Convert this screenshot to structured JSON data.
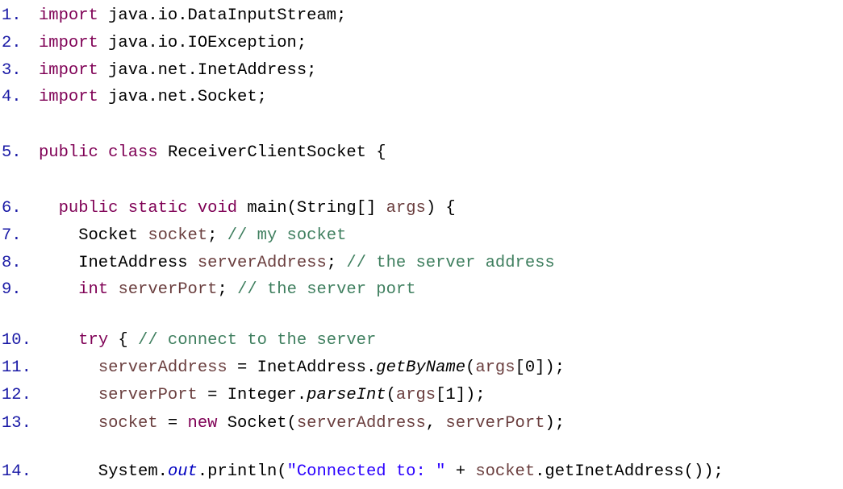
{
  "lines": [
    {
      "num": "1.",
      "tokens": [
        {
          "t": "import",
          "c": "kw"
        },
        {
          "t": " java.io.DataInputStream;",
          "c": ""
        }
      ]
    },
    {
      "num": "2.",
      "tokens": [
        {
          "t": "import",
          "c": "kw"
        },
        {
          "t": " java.io.IOException;",
          "c": ""
        }
      ]
    },
    {
      "num": "3.",
      "tokens": [
        {
          "t": "import",
          "c": "kw"
        },
        {
          "t": " java.net.InetAddress;",
          "c": ""
        }
      ]
    },
    {
      "num": "4.",
      "tokens": [
        {
          "t": "import",
          "c": "kw"
        },
        {
          "t": " java.net.Socket;",
          "c": ""
        }
      ]
    },
    {
      "num": "5.",
      "tokens": [
        {
          "t": "public",
          "c": "kw"
        },
        {
          "t": " ",
          "c": ""
        },
        {
          "t": "class",
          "c": "kw"
        },
        {
          "t": " ReceiverClientSocket {",
          "c": ""
        }
      ]
    },
    {
      "num": "6.",
      "tokens": [
        {
          "t": "  ",
          "c": ""
        },
        {
          "t": "public",
          "c": "kw"
        },
        {
          "t": " ",
          "c": ""
        },
        {
          "t": "static",
          "c": "kw"
        },
        {
          "t": " ",
          "c": ""
        },
        {
          "t": "void",
          "c": "kw"
        },
        {
          "t": " main(String[] ",
          "c": ""
        },
        {
          "t": "args",
          "c": "var"
        },
        {
          "t": ") {",
          "c": ""
        }
      ]
    },
    {
      "num": "7.",
      "tokens": [
        {
          "t": "    Socket ",
          "c": ""
        },
        {
          "t": "socket",
          "c": "var"
        },
        {
          "t": "; ",
          "c": ""
        },
        {
          "t": "// my socket",
          "c": "cm"
        }
      ]
    },
    {
      "num": "8.",
      "tokens": [
        {
          "t": "    InetAddress ",
          "c": ""
        },
        {
          "t": "serverAddress",
          "c": "var"
        },
        {
          "t": "; ",
          "c": ""
        },
        {
          "t": "// the server address",
          "c": "cm"
        }
      ]
    },
    {
      "num": "9.",
      "tokens": [
        {
          "t": "    ",
          "c": ""
        },
        {
          "t": "int",
          "c": "kw"
        },
        {
          "t": " ",
          "c": ""
        },
        {
          "t": "serverPort",
          "c": "var"
        },
        {
          "t": "; ",
          "c": ""
        },
        {
          "t": "// the server port",
          "c": "cm"
        }
      ]
    },
    {
      "num": "10.",
      "tokens": [
        {
          "t": "    ",
          "c": ""
        },
        {
          "t": "try",
          "c": "kw"
        },
        {
          "t": " { ",
          "c": ""
        },
        {
          "t": "// connect to the server",
          "c": "cm"
        }
      ]
    },
    {
      "num": "11.",
      "tokens": [
        {
          "t": "      ",
          "c": ""
        },
        {
          "t": "serverAddress",
          "c": "var"
        },
        {
          "t": " = InetAddress.",
          "c": ""
        },
        {
          "t": "getByName",
          "c": "it"
        },
        {
          "t": "(",
          "c": ""
        },
        {
          "t": "args",
          "c": "var"
        },
        {
          "t": "[0]);",
          "c": ""
        }
      ]
    },
    {
      "num": "12.",
      "tokens": [
        {
          "t": "      ",
          "c": ""
        },
        {
          "t": "serverPort",
          "c": "var"
        },
        {
          "t": " = Integer.",
          "c": ""
        },
        {
          "t": "parseInt",
          "c": "it"
        },
        {
          "t": "(",
          "c": ""
        },
        {
          "t": "args",
          "c": "var"
        },
        {
          "t": "[1]);",
          "c": ""
        }
      ]
    },
    {
      "num": "13.",
      "tokens": [
        {
          "t": "      ",
          "c": ""
        },
        {
          "t": "socket",
          "c": "var"
        },
        {
          "t": " = ",
          "c": ""
        },
        {
          "t": "new",
          "c": "kw"
        },
        {
          "t": " Socket(",
          "c": ""
        },
        {
          "t": "serverAddress",
          "c": "var"
        },
        {
          "t": ", ",
          "c": ""
        },
        {
          "t": "serverPort",
          "c": "var"
        },
        {
          "t": ");",
          "c": ""
        }
      ]
    },
    {
      "num": "14.",
      "tokens": [
        {
          "t": "      System.",
          "c": ""
        },
        {
          "t": "out",
          "c": "fld"
        },
        {
          "t": ".println(",
          "c": ""
        },
        {
          "t": "\"Connected to: \"",
          "c": "str"
        },
        {
          "t": " + ",
          "c": ""
        },
        {
          "t": "socket",
          "c": "var"
        },
        {
          "t": ".getInetAddress());",
          "c": ""
        }
      ]
    }
  ],
  "colors": {
    "line_number": "#1a1aa6",
    "keyword": "#7f0055",
    "variable": "#6a3e3e",
    "comment": "#3f7f5f",
    "string": "#2a00ff",
    "static_field": "#0000c0"
  }
}
